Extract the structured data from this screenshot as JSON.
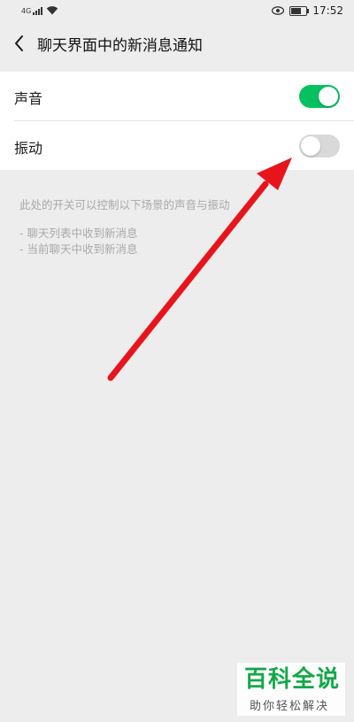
{
  "status_bar": {
    "signal_label": "4G",
    "time": "17:52",
    "battery_level": 0.7
  },
  "nav": {
    "back_icon": "chevron-left-icon",
    "title": "聊天界面中的新消息通知"
  },
  "settings": [
    {
      "label": "声音",
      "enabled": true
    },
    {
      "label": "振动",
      "enabled": false
    }
  ],
  "description": {
    "text": "此处的开关可以控制以下场景的声音与振动",
    "bullets": [
      "- 聊天列表中收到新消息",
      "- 当前聊天中收到新消息"
    ]
  },
  "annotation": {
    "arrow_color": "#e8141b"
  },
  "watermark": {
    "title": "百科全说",
    "subtitle": "助你轻松解决",
    "color": "#14a84a"
  },
  "colors": {
    "accent_on": "#07c160",
    "toggle_off": "#d9d9d9",
    "background": "#ededed"
  }
}
